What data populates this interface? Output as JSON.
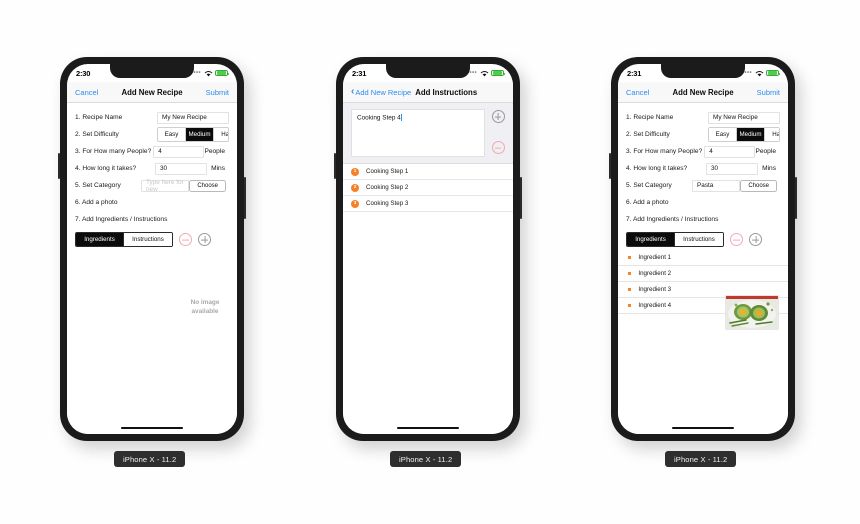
{
  "app": {
    "background_color": "#fefefe",
    "accent_blue": "#2b8cf0",
    "accent_orange": "#f58025",
    "minus_pink": "#f0aab0"
  },
  "devices": [
    {
      "caption": "iPhone X - 11.2",
      "status": {
        "time": "2:30",
        "signal": "signal-dots-icon",
        "wifi": "wifi-icon",
        "battery": "battery-icon"
      },
      "nav": {
        "left": "Cancel",
        "title": "Add New Recipe",
        "right": "Submit"
      },
      "form": {
        "rows": [
          {
            "label": "1. Recipe Name",
            "value": "My New Recipe"
          },
          {
            "label": "2. Set Difficulty"
          },
          {
            "label": "3. For How many People?",
            "value": "4",
            "unit": "People"
          },
          {
            "label": "4. How long it takes?",
            "value": "30",
            "unit": "Mins"
          },
          {
            "label": "5. Set Category",
            "placeholder": "Type here for new",
            "button": "Choose"
          },
          {
            "label": "6. Add a photo"
          },
          {
            "label": "7. Add Ingredients / Instructions"
          }
        ],
        "difficulty": {
          "options": [
            "Easy",
            "Medium",
            "Hard"
          ],
          "selected": "Medium"
        },
        "photo_placeholder": "No image available"
      },
      "tabs": {
        "options": [
          "Ingredients",
          "Instructions"
        ],
        "selected": "Ingredients",
        "minus": "minus-icon",
        "plus": "plus-icon"
      },
      "list": []
    },
    {
      "caption": "iPhone X - 11.2",
      "status": {
        "time": "2:31",
        "signal": "signal-dots-icon",
        "wifi": "wifi-icon",
        "battery": "battery-icon"
      },
      "nav": {
        "back_chevron": "chevron-left-icon",
        "back_label": "Add New Recipe",
        "title": "Add Instructions"
      },
      "editor": {
        "value": "Cooking Step 4",
        "plus": "plus-icon",
        "minus": "minus-icon"
      },
      "list": [
        {
          "badge": "1",
          "text": "Cooking Step 1"
        },
        {
          "badge": "2",
          "text": "Cooking Step 2"
        },
        {
          "badge": "3",
          "text": "Cooking Step 3"
        }
      ]
    },
    {
      "caption": "iPhone X - 11.2",
      "status": {
        "time": "2:31",
        "signal": "signal-dots-icon",
        "wifi": "wifi-icon",
        "battery": "battery-icon"
      },
      "nav": {
        "left": "Cancel",
        "title": "Add New Recipe",
        "right": "Submit"
      },
      "form": {
        "rows": [
          {
            "label": "1. Recipe Name",
            "value": "My New Recipe"
          },
          {
            "label": "2. Set Difficulty"
          },
          {
            "label": "3. For How many People?",
            "value": "4",
            "unit": "People"
          },
          {
            "label": "4. How long it takes?",
            "value": "30",
            "unit": "Mins"
          },
          {
            "label": "5. Set Category",
            "value": "Pasta",
            "button": "Choose"
          },
          {
            "label": "6. Add a photo"
          },
          {
            "label": "7. Add Ingredients / Instructions"
          }
        ],
        "difficulty": {
          "options": [
            "Easy",
            "Medium",
            "Hard"
          ],
          "selected": "Medium"
        },
        "photo": "recipe-photo-avocado-eggs"
      },
      "tabs": {
        "options": [
          "Ingredients",
          "Instructions"
        ],
        "selected": "Ingredients",
        "minus": "minus-icon",
        "plus": "plus-icon"
      },
      "list": [
        {
          "text": "Ingredient 1"
        },
        {
          "text": "Ingredient 2"
        },
        {
          "text": "Ingredient 3"
        },
        {
          "text": "Ingredient 4"
        }
      ]
    }
  ]
}
